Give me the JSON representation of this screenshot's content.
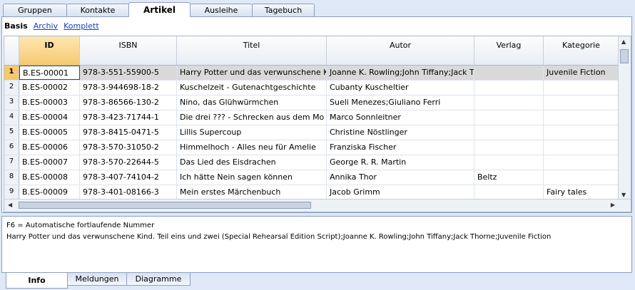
{
  "top_tabs": [
    {
      "label": "Gruppen"
    },
    {
      "label": "Kontakte"
    },
    {
      "label": "Artikel"
    },
    {
      "label": "Ausleihe"
    },
    {
      "label": "Tagebuch"
    }
  ],
  "views": {
    "basis": "Basis",
    "archiv": "Archiv",
    "komplett": "Komplett"
  },
  "columns": [
    "ID",
    "ISBN",
    "Titel",
    "Autor",
    "Verlag",
    "Kategorie"
  ],
  "rows": [
    {
      "num": "1",
      "id": "B.ES-00001",
      "isbn": "978-3-551-55900-5",
      "titel": "Harry Potter und das verwunschene K",
      "autor": "Joanne K. Rowling;John Tiffany;Jack T",
      "verlag": "",
      "kategorie": "Juvenile Fiction"
    },
    {
      "num": "2",
      "id": "B.ES-00002",
      "isbn": "978-3-944698-18-2",
      "titel": "Kuschelzeit - Gutenachtgeschichte",
      "autor": "Cubanty Kuscheltier",
      "verlag": "",
      "kategorie": ""
    },
    {
      "num": "3",
      "id": "B.ES-00003",
      "isbn": "978-3-86566-130-2",
      "titel": "Nino, das Glühwürmchen",
      "autor": "Sueli Menezes;Giuliano Ferri",
      "verlag": "",
      "kategorie": ""
    },
    {
      "num": "4",
      "id": "B.ES-00004",
      "isbn": "978-3-423-71744-1",
      "titel": "Die drei ??? - Schrecken aus dem Mo",
      "autor": "Marco Sonnleitner",
      "verlag": "",
      "kategorie": ""
    },
    {
      "num": "5",
      "id": "B.ES-00005",
      "isbn": "978-3-8415-0471-5",
      "titel": "Lillis Supercoup",
      "autor": "Christine Nöstlinger",
      "verlag": "",
      "kategorie": ""
    },
    {
      "num": "6",
      "id": "B.ES-00006",
      "isbn": "978-3-570-31050-2",
      "titel": "Himmelhoch - Alles neu für Amelie",
      "autor": "Franziska Fischer",
      "verlag": "",
      "kategorie": ""
    },
    {
      "num": "7",
      "id": "B.ES-00007",
      "isbn": "978-3-570-22644-5",
      "titel": "Das Lied des Eisdrachen",
      "autor": "George R. R. Martin",
      "verlag": "",
      "kategorie": ""
    },
    {
      "num": "8",
      "id": "B.ES-00008",
      "isbn": "978-3-407-74104-2",
      "titel": "Ich hätte Nein sagen können",
      "autor": "Annika Thor",
      "verlag": "Beltz",
      "kategorie": ""
    },
    {
      "num": "9",
      "id": "B.ES-00009",
      "isbn": "978-3-401-08166-3",
      "titel": "Mein erstes Märchenbuch",
      "autor": "Jacob Grimm",
      "verlag": "",
      "kategorie": "Fairy tales"
    }
  ],
  "info": {
    "line1": "F6 = Automatische fortlaufende Nummer",
    "line2": "Harry Potter und das verwunschene Kind. Teil eins und zwei (Special Rehearsal Edition Script);Joanne K. Rowling;John Tiffany;Jack Thorne;Juvenile Fiction"
  },
  "bottom_tabs": [
    {
      "label": "Info"
    },
    {
      "label": "Meldungen"
    },
    {
      "label": "Diagramme"
    }
  ]
}
